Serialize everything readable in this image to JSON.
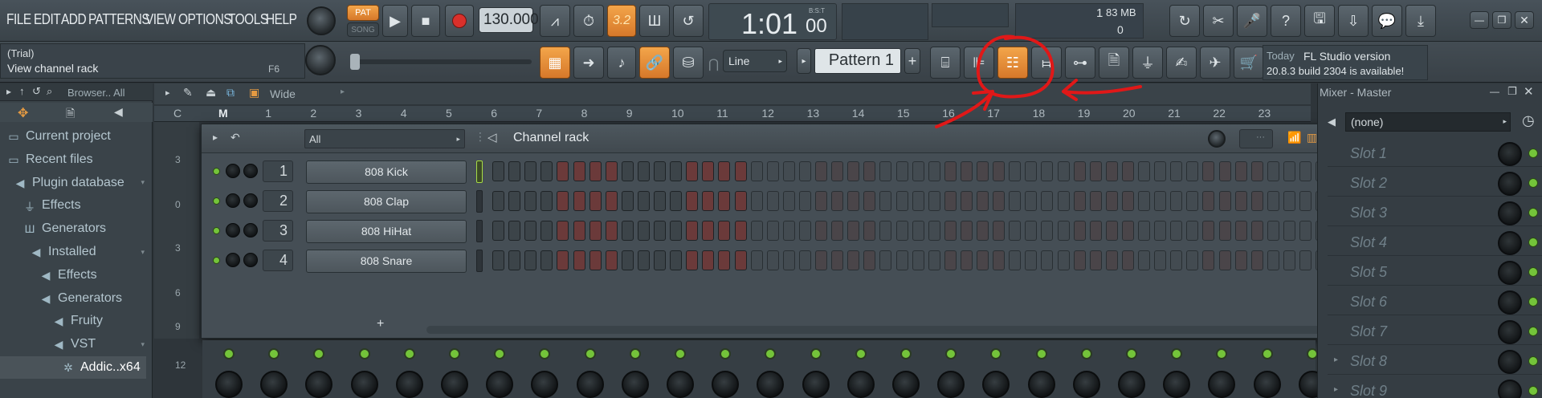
{
  "menu": [
    "FILE",
    "EDIT",
    "ADD",
    "PATTERNS",
    "VIEW",
    "OPTIONS",
    "TOOLS",
    "HELP"
  ],
  "transport": {
    "pat_label": "PAT",
    "song_label": "SONG",
    "tempo": "130.000",
    "countdown": "3.2",
    "time_main": "1:01",
    "time_sub": "00",
    "time_label": "B:S:T"
  },
  "cpu": {
    "value": "1",
    "memory": "83 MB",
    "polyphony": "0"
  },
  "hint": {
    "line1": "(Trial)",
    "line2": "View channel rack",
    "shortcut": "F6"
  },
  "snap": {
    "label": "Line"
  },
  "pattern": {
    "name": "Pattern 1",
    "add": "+"
  },
  "news": {
    "prefix": "Today",
    "line1": "FL Studio version",
    "line2": "20.8.3 build 2304 is available!"
  },
  "browser": {
    "header": "Browser.. All",
    "items": [
      {
        "label": "Current project",
        "icon": "folder-icon"
      },
      {
        "label": "Recent files",
        "icon": "folder-icon"
      },
      {
        "label": "Plugin database",
        "icon": "speaker-icon"
      },
      {
        "label": "Effects",
        "icon": "plug-icon"
      },
      {
        "label": "Generators",
        "icon": "piano-icon"
      },
      {
        "label": "Installed",
        "icon": "speaker-icon"
      },
      {
        "label": "Effects",
        "icon": "speaker-icon"
      },
      {
        "label": "Generators",
        "icon": "speaker-icon"
      },
      {
        "label": "Fruity",
        "icon": "speaker-icon"
      },
      {
        "label": "VST",
        "icon": "speaker-icon"
      },
      {
        "label": "Addic..x64",
        "icon": "gear-icon"
      }
    ]
  },
  "playlist": {
    "title": "Wide",
    "ruler": [
      "C",
      "M",
      "1",
      "2",
      "3",
      "4",
      "5",
      "6",
      "7",
      "8",
      "9",
      "10",
      "11",
      "12",
      "13",
      "14",
      "15",
      "16",
      "17",
      "18",
      "19",
      "20",
      "21",
      "22",
      "23"
    ],
    "side_numbers": [
      "3",
      "0",
      "3",
      "6",
      "9",
      "12"
    ]
  },
  "channel_rack": {
    "title": "Channel rack",
    "filter": "All",
    "add_label": "+",
    "channels": [
      {
        "num": "1",
        "name": "808 Kick",
        "selected": true
      },
      {
        "num": "2",
        "name": "808 Clap",
        "selected": false
      },
      {
        "num": "3",
        "name": "808 HiHat",
        "selected": false
      },
      {
        "num": "4",
        "name": "808 Snare",
        "selected": false
      }
    ],
    "steps": 32,
    "step_colors": {
      "dark": "#3c4449",
      "red": "#6b3a3a",
      "light_dark": "#4a5257",
      "light_red": "#5a4446"
    }
  },
  "mixer": {
    "title": "Mixer - Master",
    "selected": "(none)",
    "slots": [
      "Slot 1",
      "Slot 2",
      "Slot 3",
      "Slot 4",
      "Slot 5",
      "Slot 6",
      "Slot 7",
      "Slot 8",
      "Slot 9"
    ]
  },
  "colors": {
    "accent_orange": "#e08a36",
    "annotation_red": "#e01818",
    "led_green": "#74c43a"
  }
}
